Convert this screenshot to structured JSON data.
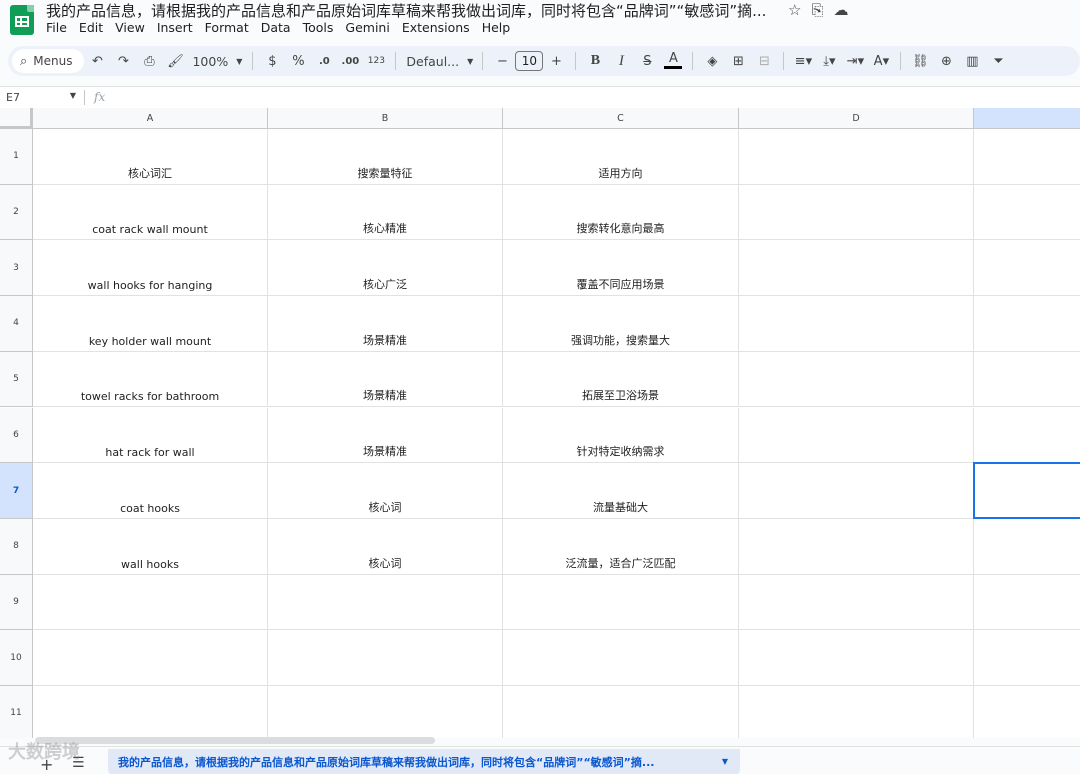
{
  "window": {
    "title": "我的产品信息，请根据我的产品信息和产品原始词库草稿来帮我做出词库，同时将包含“品牌词”“敏感词”摘...",
    "icons": [
      "star-icon",
      "move-to-folder-icon",
      "cloud-saved-icon"
    ]
  },
  "menu": [
    "File",
    "Edit",
    "View",
    "Insert",
    "Format",
    "Data",
    "Tools",
    "Gemini",
    "Extensions",
    "Help"
  ],
  "toolbar": {
    "search_label": "Menus",
    "zoom": "100%",
    "currency": "$",
    "percent": "%",
    "decrease_decimal": ".0",
    "increase_decimal": ".00",
    "number_format": "123",
    "font": "Defaul...",
    "font_size": "10",
    "minus": "−",
    "plus": "+",
    "bold": "B",
    "italic": "I",
    "strike": "S",
    "text_color": "A",
    "text_color_value": "#000000"
  },
  "formula_bar": {
    "cell_ref": "E7",
    "fx": "fx",
    "content": ""
  },
  "grid": {
    "columns": [
      "A",
      "B",
      "C",
      "D",
      ""
    ],
    "selected_column": 4,
    "selected_row": 7,
    "row_numbers": [
      "1",
      "2",
      "3",
      "4",
      "5",
      "6",
      "7",
      "8",
      "9",
      "10",
      "11"
    ],
    "rows": [
      [
        "核心词汇",
        "搜索量特征",
        "适用方向",
        "",
        ""
      ],
      [
        "coat rack wall mount",
        "核心精准",
        "搜索转化意向最高",
        "",
        ""
      ],
      [
        "wall hooks for hanging",
        "核心广泛",
        "覆盖不同应用场景",
        "",
        ""
      ],
      [
        "key holder wall mount",
        "场景精准",
        "强调功能，搜索量大",
        "",
        ""
      ],
      [
        "towel racks for bathroom",
        "场景精准",
        "拓展至卫浴场景",
        "",
        ""
      ],
      [
        "hat rack for wall",
        "场景精准",
        "针对特定收纳需求",
        "",
        ""
      ],
      [
        "coat hooks",
        "核心词",
        "流量基础大",
        "",
        ""
      ],
      [
        "wall hooks",
        "核心词",
        "泛流量，适合广泛匹配",
        "",
        ""
      ],
      [
        "",
        "",
        "",
        "",
        ""
      ],
      [
        "",
        "",
        "",
        "",
        ""
      ],
      [
        "",
        "",
        "",
        "",
        ""
      ]
    ]
  },
  "sheets": {
    "active_tab": "我的产品信息，请根据我的产品信息和产品原始词库草稿来帮我做出词库，同时将包含“品牌词”“敏感词”摘..."
  },
  "watermark": "大数跨境",
  "colors": {
    "accent": "#1a73e8",
    "header_selected": "#d3e3fd",
    "sheets_green": "#0f9d58"
  }
}
